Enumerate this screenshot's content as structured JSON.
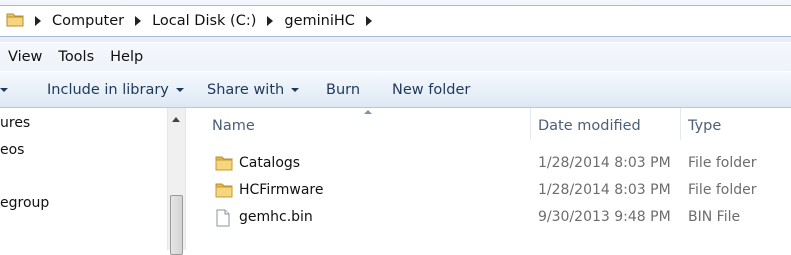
{
  "address_bar": {
    "crumbs": [
      "Computer",
      "Local Disk (C:)",
      "geminiHC"
    ]
  },
  "menu": [
    "View",
    "Tools",
    "Help"
  ],
  "toolbar": {
    "organize_caret": "",
    "include_in_library": "Include in library",
    "share_with": "Share with",
    "burn": "Burn",
    "new_folder": "New folder"
  },
  "nav_pane": {
    "items": [
      "ures",
      "eos",
      "egroup"
    ]
  },
  "columns": {
    "name": "Name",
    "date_modified": "Date modified",
    "type": "Type"
  },
  "files": [
    {
      "name": "Catalogs",
      "date": "1/28/2014 8:03 PM",
      "type": "File folder",
      "icon": "folder-icon"
    },
    {
      "name": "HCFirmware",
      "date": "1/28/2014 8:03 PM",
      "type": "File folder",
      "icon": "folder-icon"
    },
    {
      "name": "gemhc.bin",
      "date": "9/30/2013 9:48 PM",
      "type": "BIN File",
      "icon": "file-icon"
    }
  ]
}
